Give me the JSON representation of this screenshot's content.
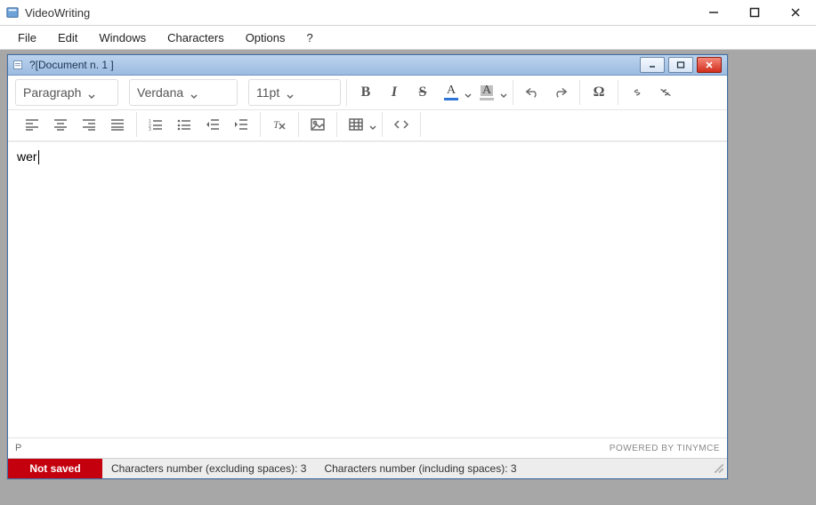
{
  "app_title": "VideoWriting",
  "menubar": {
    "items": [
      "File",
      "Edit",
      "Windows",
      "Characters",
      "Options",
      "?"
    ]
  },
  "document": {
    "title": "?[Document n. 1 ]",
    "content": "wer",
    "status_path": "P",
    "powered_by": "POWERED BY TINYMCE"
  },
  "toolbar": {
    "paragraph_label": "Paragraph",
    "font_label": "Verdana",
    "size_label": "11pt",
    "text_color": "#2f75d8",
    "highlight_color": "#bfbfbf"
  },
  "status_strip": {
    "badge": "Not saved",
    "excl_label": "Characters number (excluding spaces):",
    "excl_value": "3",
    "incl_label": "Characters number (including spaces):",
    "incl_value": "3"
  }
}
